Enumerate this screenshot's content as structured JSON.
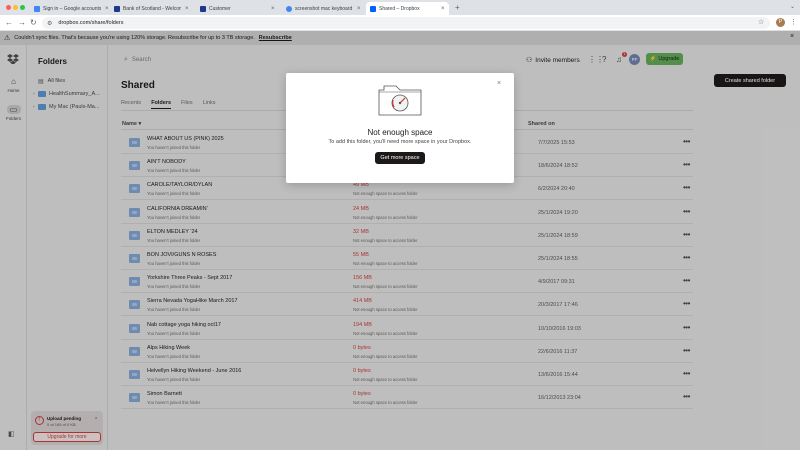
{
  "browser": {
    "tabs": [
      {
        "label": "Sign in – Google accounts",
        "color": "#4285f4",
        "active": false
      },
      {
        "label": "Bank of Scotland - Welcome",
        "color": "#1b3a8f",
        "active": false
      },
      {
        "label": "Customer",
        "color": "#1b3a8f",
        "active": false
      },
      {
        "label": "screenshot mac keyboard - G",
        "color": "#4285f4",
        "active": false
      },
      {
        "label": "Shared – Dropbox",
        "color": "#0061fe",
        "active": true
      }
    ],
    "url": "dropbox.com/share/folders",
    "profile_initial": "P"
  },
  "banner": {
    "message": "Couldn't sync files. That's because you're using 120% storage. Resubscribe for up to 3 TB storage.",
    "link": "Resubscribe"
  },
  "rail": {
    "home": "Home",
    "folders": "Folders"
  },
  "sidebar": {
    "title": "Folders",
    "all_files": "All files",
    "items": [
      {
        "label": "HealthSummary_A..."
      },
      {
        "label": "My Mac (Pauls-Ma..."
      }
    ],
    "upload": {
      "title": "Upload pending",
      "subtitle": "0 of 169 of 0 KB",
      "button": "Upgrade for more"
    }
  },
  "header": {
    "search_placeholder": "Search",
    "invite": "Invite members",
    "notification_count": "1",
    "avatar_initials": "PF",
    "upgrade": "Upgrade"
  },
  "page": {
    "title": "Shared",
    "tabs": [
      "Recents",
      "Folders",
      "Files",
      "Links"
    ],
    "active_tab": "Folders",
    "create_button": "Create shared folder",
    "columns": {
      "name": "Name",
      "shared_on": "Shared on"
    }
  },
  "rows": [
    {
      "name": "WHAT ABOUT US (PINK) 2025",
      "sub": "You haven't joined this folder",
      "size": "",
      "size_sub": "",
      "date": "7/7/2025 15:53"
    },
    {
      "name": "AIN'T NOBODY",
      "sub": "You haven't joined this folder",
      "size": "",
      "size_sub": "",
      "date": "18/6/2024 18:52"
    },
    {
      "name": "CAROLE/TAYLOR/DYLAN",
      "sub": "You haven't joined this folder",
      "size": "49 MB",
      "size_sub": "Not enough space to access folder",
      "date": "6/2/2024 20:40"
    },
    {
      "name": "CALIFORNIA DREAMIN'",
      "sub": "You haven't joined this folder",
      "size": "24 MB",
      "size_sub": "Not enough space to access folder",
      "date": "25/1/2024 19:20"
    },
    {
      "name": "ELTON MEDLEY '24",
      "sub": "You haven't joined this folder",
      "size": "32 MB",
      "size_sub": "Not enough space to access folder",
      "date": "25/1/2024 18:59"
    },
    {
      "name": "BON JOVI/GUNS N ROSES",
      "sub": "You haven't joined this folder",
      "size": "55 MB",
      "size_sub": "Not enough space to access folder",
      "date": "25/1/2024 18:55"
    },
    {
      "name": "Yorkshire Three Peaks - Sept 2017",
      "sub": "You haven't joined this folder",
      "size": "156 MB",
      "size_sub": "Not enough space to access folder",
      "date": "4/9/2017 09:31"
    },
    {
      "name": "Sierra Nevada YogaHike March 2017",
      "sub": "You haven't joined this folder",
      "size": "414 MB",
      "size_sub": "Not enough space to access folder",
      "date": "20/3/2017 17:46"
    },
    {
      "name": "Nab cottage yoga hiking oct17",
      "sub": "You haven't joined this folder",
      "size": "194 MB",
      "size_sub": "Not enough space to access folder",
      "date": "10/10/2016 19:03"
    },
    {
      "name": "Alps Hiking Week",
      "sub": "You haven't joined this folder",
      "size": "0 bytes",
      "size_sub": "Not enough space to access folder",
      "date": "22/6/2016 11:37"
    },
    {
      "name": "Helvellyn Hiking Weekend - June 2016",
      "sub": "You haven't joined this folder",
      "size": "0 bytes",
      "size_sub": "Not enough space to access folder",
      "date": "13/6/2016 15:44"
    },
    {
      "name": "Simon Barnett",
      "sub": "You haven't joined this folder",
      "size": "0 bytes",
      "size_sub": "Not enough space to access folder",
      "date": "16/12/2013 23:04"
    }
  ],
  "modal": {
    "title": "Not enough space",
    "body": "To add this folder, you'll need more space in your Dropbox.",
    "button": "Get more space"
  },
  "colors": {
    "accent_red": "#c03c3c",
    "upgrade_green": "#5fa356",
    "dark": "#1e1919"
  }
}
